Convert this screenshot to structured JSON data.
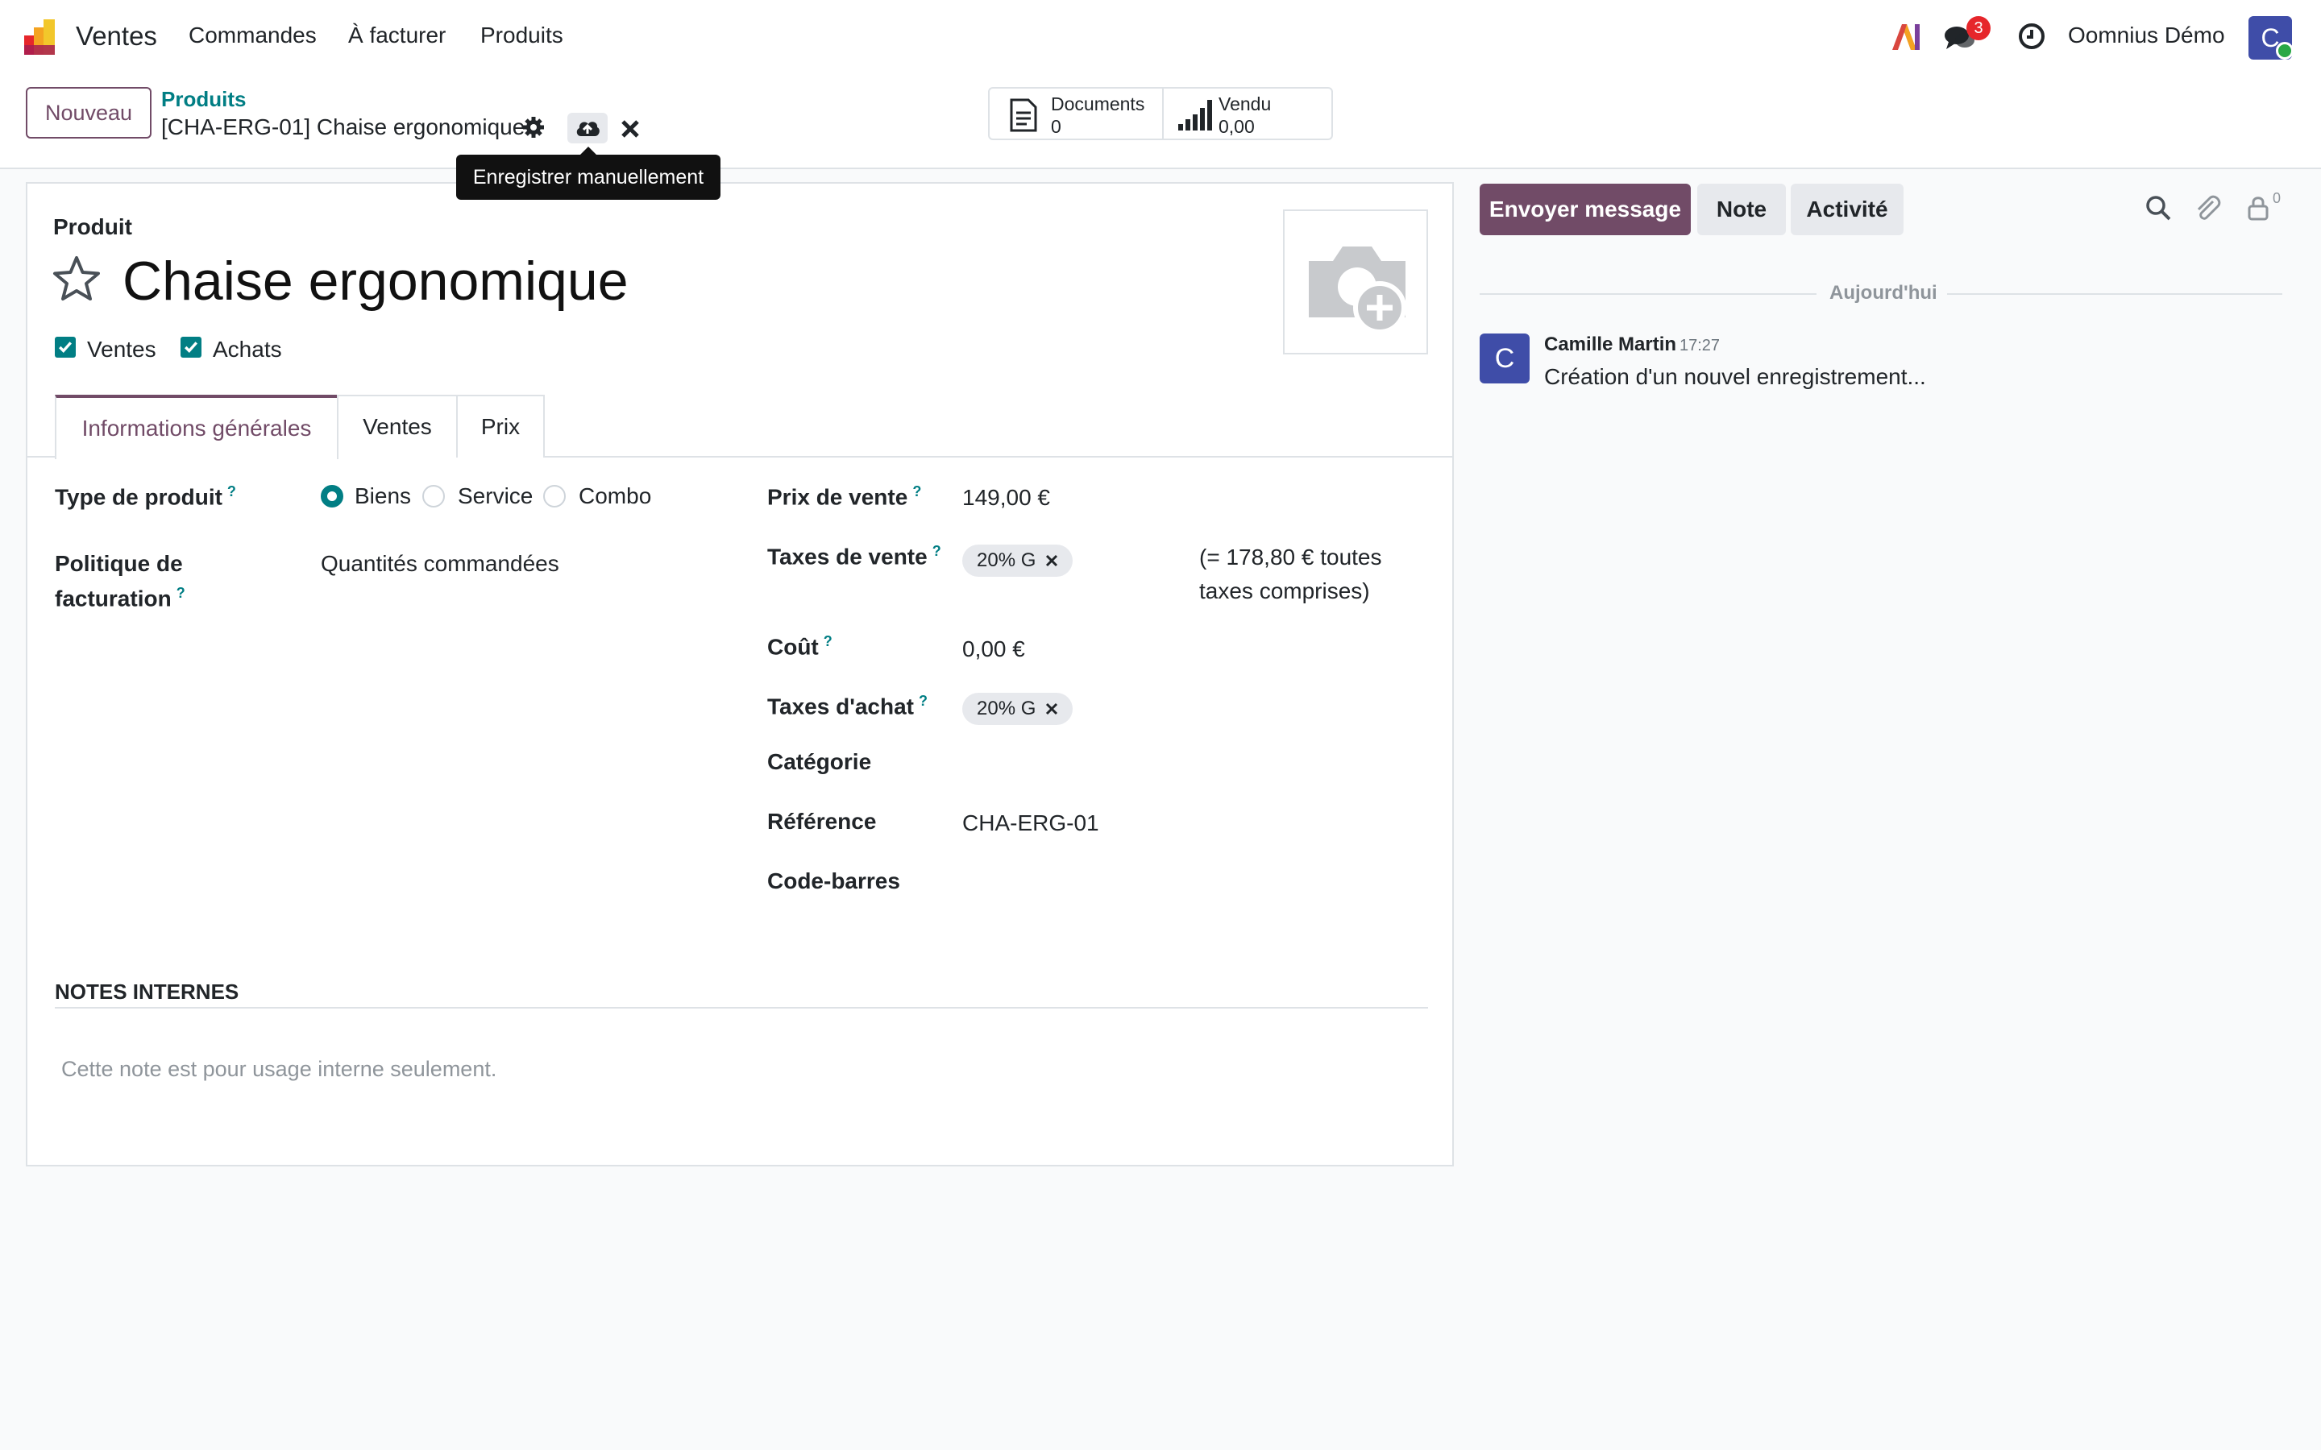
{
  "navbar": {
    "app_name": "Ventes",
    "menu": [
      "Commandes",
      "À facturer",
      "Produits"
    ],
    "messages_count": "3",
    "user_name": "Oomnius Démo",
    "avatar_letter": "C"
  },
  "control": {
    "new_label": "Nouveau",
    "breadcrumb": "Produits",
    "record_title": "[CHA-ERG-01] Chaise ergonomique",
    "smart_documents_label": "Documents",
    "smart_documents_value": "0",
    "smart_sold_label": "Vendu",
    "smart_sold_value": "0,00",
    "tooltip": "Enregistrer manuellement"
  },
  "form": {
    "header_label": "Produit",
    "product_name": "Chaise ergonomique",
    "check_sales": "Ventes",
    "check_purchase": "Achats",
    "tabs": [
      "Informations générales",
      "Ventes",
      "Prix"
    ],
    "fields": {
      "product_type_label": "Type de produit",
      "product_type_options": [
        "Biens",
        "Service",
        "Combo"
      ],
      "invoice_policy_label_1": "Politique de",
      "invoice_policy_label_2": "facturation",
      "invoice_policy_value": "Quantités commandées",
      "sale_price_label": "Prix de vente",
      "sale_price_value": "149,00 €",
      "sale_tax_label": "Taxes de vente",
      "sale_tax_tag": "20% G",
      "tax_included_1": "(= 178,80 € toutes",
      "tax_included_2": "taxes comprises)",
      "cost_label": "Coût",
      "cost_value": "0,00 €",
      "purchase_tax_label": "Taxes d'achat",
      "purchase_tax_tag": "20% G",
      "category_label": "Catégorie",
      "reference_label": "Référence",
      "reference_value": "CHA-ERG-01",
      "barcode_label": "Code-barres",
      "help_mark": "?"
    },
    "notes_title": "NOTES INTERNES",
    "notes_placeholder": "Cette note est pour usage interne seulement."
  },
  "chatter": {
    "send_message": "Envoyer message",
    "note": "Note",
    "activity": "Activité",
    "followers_count": "0",
    "today": "Aujourd'hui",
    "author": "Camille Martin",
    "time": "17:27",
    "message": "Création d'un nouvel enregistrement...",
    "author_initial": "C"
  },
  "colors": {
    "brand": "#714b67",
    "teal": "#017e84",
    "badge": "#e6262b",
    "avatar": "#3f4da8"
  }
}
